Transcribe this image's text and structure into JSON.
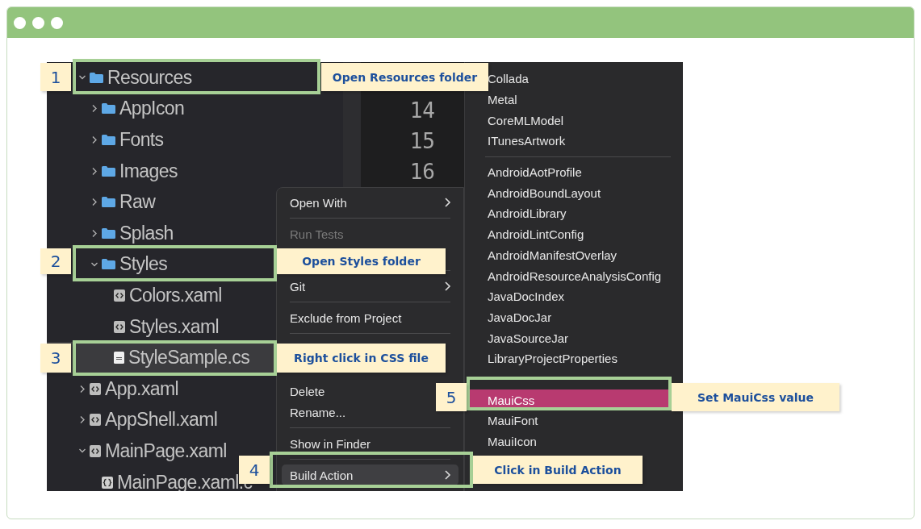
{
  "tree": {
    "items": [
      {
        "label": "Resources",
        "kind": "folder",
        "expanded": true,
        "selected": false,
        "children": [
          {
            "label": "AppIcon",
            "kind": "folder",
            "expanded": false,
            "selected": false
          },
          {
            "label": "Fonts",
            "kind": "folder",
            "expanded": false,
            "selected": false
          },
          {
            "label": "Images",
            "kind": "folder",
            "expanded": false,
            "selected": false
          },
          {
            "label": "Raw",
            "kind": "folder",
            "expanded": false,
            "selected": false
          },
          {
            "label": "Splash",
            "kind": "folder",
            "expanded": false,
            "selected": false
          },
          {
            "label": "Styles",
            "kind": "folder",
            "expanded": true,
            "selected": false,
            "children": [
              {
                "label": "Colors.xaml",
                "kind": "xaml",
                "selected": false
              },
              {
                "label": "Styles.xaml",
                "kind": "xaml",
                "selected": false
              },
              {
                "label": "StyleSample.cs",
                "kind": "css",
                "selected": true
              }
            ]
          }
        ]
      },
      {
        "label": "App.xaml",
        "kind": "xaml",
        "expanded": false,
        "selected": false
      },
      {
        "label": "AppShell.xaml",
        "kind": "xaml",
        "expanded": false,
        "selected": false
      },
      {
        "label": "MainPage.xaml",
        "kind": "xaml",
        "expanded": true,
        "selected": false,
        "children": [
          {
            "label": "MainPage.xaml.c",
            "kind": "code",
            "selected": false
          }
        ]
      }
    ]
  },
  "editor": {
    "line_numbers": [
      "14",
      "15",
      "16"
    ]
  },
  "context_menu": {
    "items": [
      {
        "kind": "item",
        "label": "Open With",
        "submenu": true,
        "disabled": false,
        "selected": false
      },
      {
        "kind": "separator"
      },
      {
        "kind": "item",
        "label": "Run Tests",
        "submenu": false,
        "disabled": true,
        "selected": false
      },
      {
        "kind": "gap"
      },
      {
        "kind": "separator"
      },
      {
        "kind": "item",
        "label": "Git",
        "submenu": true,
        "disabled": false,
        "selected": false
      },
      {
        "kind": "separator"
      },
      {
        "kind": "item",
        "label": "Exclude from Project",
        "submenu": false,
        "disabled": false,
        "selected": false
      },
      {
        "kind": "separator"
      },
      {
        "kind": "gap"
      },
      {
        "kind": "gap"
      },
      {
        "kind": "item",
        "label": "Delete",
        "submenu": false,
        "disabled": false,
        "selected": false
      },
      {
        "kind": "item",
        "label": "Rename...",
        "submenu": false,
        "disabled": false,
        "selected": false
      },
      {
        "kind": "separator"
      },
      {
        "kind": "item",
        "label": "Show in Finder",
        "submenu": false,
        "disabled": false,
        "selected": false
      },
      {
        "kind": "separator"
      },
      {
        "kind": "item",
        "label": "Build Action",
        "submenu": true,
        "disabled": false,
        "selected": true
      }
    ]
  },
  "build_action_menu": {
    "items": [
      {
        "kind": "item",
        "label": "Collada",
        "selected": false
      },
      {
        "kind": "item",
        "label": "Metal",
        "selected": false
      },
      {
        "kind": "item",
        "label": "CoreMLModel",
        "selected": false
      },
      {
        "kind": "item",
        "label": "ITunesArtwork",
        "selected": false
      },
      {
        "kind": "separator"
      },
      {
        "kind": "item",
        "label": "AndroidAotProfile",
        "selected": false
      },
      {
        "kind": "item",
        "label": "AndroidBoundLayout",
        "selected": false
      },
      {
        "kind": "item",
        "label": "AndroidLibrary",
        "selected": false
      },
      {
        "kind": "item",
        "label": "AndroidLintConfig",
        "selected": false
      },
      {
        "kind": "item",
        "label": "AndroidManifestOverlay",
        "selected": false
      },
      {
        "kind": "item",
        "label": "AndroidResourceAnalysisConfig",
        "selected": false
      },
      {
        "kind": "item",
        "label": "JavaDocIndex",
        "selected": false
      },
      {
        "kind": "item",
        "label": "JavaDocJar",
        "selected": false
      },
      {
        "kind": "item",
        "label": "JavaSourceJar",
        "selected": false
      },
      {
        "kind": "item",
        "label": "LibraryProjectProperties",
        "selected": false
      },
      {
        "kind": "gap"
      },
      {
        "kind": "item",
        "label": "MauiCss",
        "selected": true
      },
      {
        "kind": "item",
        "label": "MauiFont",
        "selected": false
      },
      {
        "kind": "item",
        "label": "MauiIcon",
        "selected": false
      }
    ]
  },
  "callouts": [
    {
      "number": "1",
      "text": "Open Resources folder"
    },
    {
      "number": "2",
      "text": "Open Styles folder"
    },
    {
      "number": "3",
      "text": "Right click in CSS file"
    },
    {
      "number": "4",
      "text": "Click in Build Action"
    },
    {
      "number": "5",
      "text": "Set MauiCss value"
    }
  ]
}
